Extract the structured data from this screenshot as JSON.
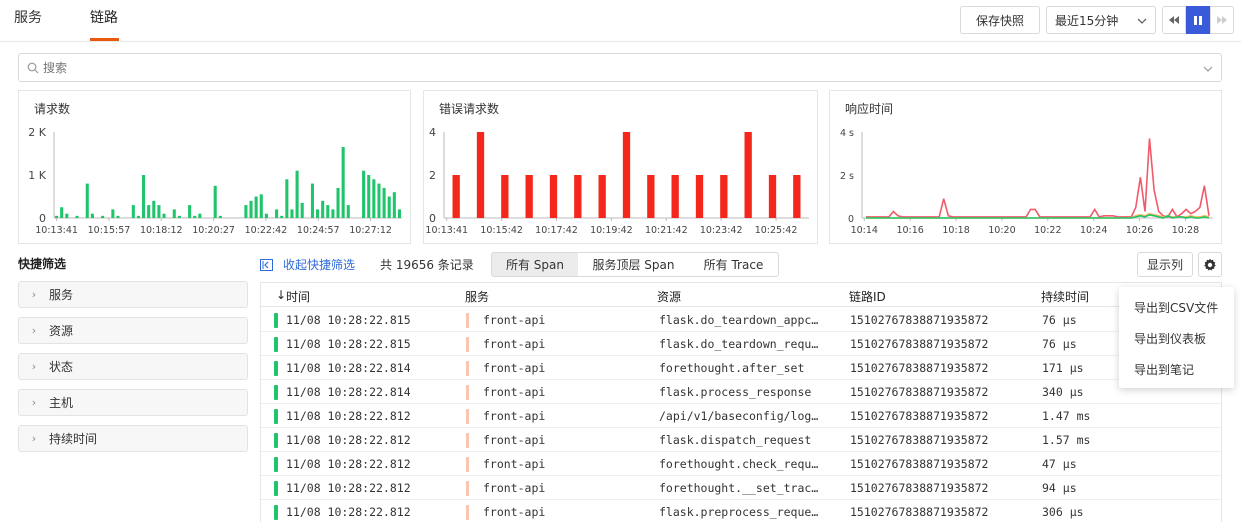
{
  "tabs": [
    {
      "label": "服务"
    },
    {
      "label": "链路"
    }
  ],
  "toolbar": {
    "save_label": "保存快照",
    "time_range": "最近15分钟"
  },
  "search": {
    "placeholder": "搜索"
  },
  "charts": {
    "requests_title": "请求数",
    "errors_title": "错误请求数",
    "latency_title": "响应时间"
  },
  "chart_data": [
    {
      "type": "bar",
      "title": "请求数",
      "color": "#20c46a",
      "ylim": [
        0,
        2000
      ],
      "yticks": [
        "2 K",
        "1 K",
        "0"
      ],
      "xticks": [
        "10:13:41",
        "10:15:57",
        "10:18:12",
        "10:20:27",
        "10:22:42",
        "10:24:57",
        "10:27:12"
      ],
      "values": [
        50,
        250,
        100,
        0,
        50,
        0,
        800,
        100,
        0,
        50,
        0,
        200,
        50,
        0,
        0,
        300,
        50,
        1000,
        300,
        400,
        300,
        100,
        0,
        200,
        50,
        0,
        300,
        50,
        100,
        0,
        0,
        750,
        50,
        0,
        0,
        0,
        0,
        300,
        400,
        500,
        550,
        100,
        0,
        200,
        50,
        900,
        200,
        1100,
        350,
        0,
        800,
        200,
        400,
        300,
        200,
        700,
        1650,
        300,
        0,
        0,
        1100,
        1000,
        900,
        800,
        700,
        500,
        600,
        200
      ]
    },
    {
      "type": "bar",
      "title": "错误请求数",
      "color": "#f5261b",
      "ylim": [
        0,
        4
      ],
      "yticks": [
        "4",
        "2",
        "0"
      ],
      "xticks": [
        "10:13:41",
        "10:15:42",
        "10:17:42",
        "10:19:42",
        "10:21:42",
        "10:23:42",
        "10:25:42"
      ],
      "values": [
        2,
        4,
        2,
        2,
        2,
        2,
        2,
        4,
        2,
        2,
        2,
        2,
        4,
        2,
        2
      ]
    },
    {
      "type": "line",
      "title": "响应时间",
      "ylim": [
        0,
        4
      ],
      "yticks": [
        "4 s",
        "2 s",
        "0"
      ],
      "xticks": [
        "10:14",
        "10:16",
        "10:18",
        "10:20",
        "10:22",
        "10:24",
        "10:26",
        "10:28"
      ],
      "series": [
        {
          "color": "#f05a6a",
          "values": [
            0.05,
            0.05,
            0.05,
            0.05,
            0.05,
            0.05,
            0.3,
            0.1,
            0.05,
            0.05,
            0.05,
            0.05,
            0.05,
            0.05,
            0.05,
            0.05,
            0.05,
            0.9,
            0.1,
            0.05,
            0.05,
            0.05,
            0.05,
            0.05,
            0.05,
            0.05,
            0.05,
            0.05,
            0.05,
            0.05,
            0.05,
            0.05,
            0.05,
            0.05,
            0.05,
            0.05,
            0.4,
            0.4,
            0.05,
            0.05,
            0.05,
            0.05,
            0.05,
            0.05,
            0.05,
            0.05,
            0.05,
            0.05,
            0.05,
            0.05,
            0.4,
            0.05,
            0.1,
            0.1,
            0.1,
            0.05,
            0.05,
            0.05,
            0.05,
            0.5,
            1.9,
            0.3,
            3.7,
            1.3,
            0.3,
            0.1,
            0.05,
            0.4,
            0.05,
            0.2,
            0.4,
            0.2,
            0.3,
            0.5,
            1.5,
            0.1
          ]
        },
        {
          "color": "#f7b955",
          "values": [
            0,
            0,
            0,
            0,
            0,
            0,
            0,
            0,
            0,
            0,
            0,
            0,
            0,
            0,
            0,
            0,
            0,
            0,
            0,
            0,
            0,
            0,
            0,
            0,
            0,
            0,
            0,
            0,
            0,
            0,
            0,
            0,
            0,
            0,
            0,
            0,
            0,
            0,
            0,
            0,
            0,
            0,
            0,
            0,
            0,
            0,
            0,
            0,
            0,
            0,
            0,
            0,
            0,
            0,
            0,
            0,
            0,
            0,
            0,
            0.1,
            0.15,
            0.1,
            0.2,
            0.15,
            0.1,
            0.05,
            0.1,
            0.05,
            0.05,
            0.05,
            0.05,
            0.1,
            0.05,
            0.05,
            0.1,
            0.05
          ]
        },
        {
          "color": "#20c46a",
          "values": [
            0,
            0,
            0,
            0,
            0,
            0,
            0,
            0,
            0,
            0,
            0,
            0,
            0,
            0,
            0,
            0,
            0,
            0,
            0,
            0,
            0,
            0,
            0,
            0,
            0,
            0,
            0,
            0,
            0,
            0,
            0,
            0,
            0,
            0,
            0,
            0,
            0,
            0,
            0,
            0,
            0,
            0,
            0,
            0,
            0,
            0,
            0,
            0,
            0,
            0,
            0,
            0,
            0,
            0,
            0,
            0,
            0,
            0,
            0,
            0.05,
            0.1,
            0.05,
            0.15,
            0.1,
            0.05,
            0,
            0.1,
            0,
            0.05,
            0.05,
            0,
            0.05,
            0,
            0,
            0.05,
            0
          ]
        }
      ]
    }
  ],
  "quick_filter": {
    "title": "快捷筛选",
    "collapse_label": "收起快捷筛选",
    "record_count": "共 19656 条记录",
    "facets": [
      "服务",
      "资源",
      "状态",
      "主机",
      "持续时间"
    ]
  },
  "span_tabs": [
    "所有 Span",
    "服务顶层 Span",
    "所有 Trace"
  ],
  "columns_button": "显示列",
  "table": {
    "headers": [
      "时间",
      "服务",
      "资源",
      "链路ID",
      "持续时间"
    ],
    "rows": [
      {
        "time": "11/08 10:28:22.815",
        "service": "front-api",
        "resource": "flask.do_teardown_appc…",
        "trace_id": "15102767838871935872",
        "duration": "76 µs"
      },
      {
        "time": "11/08 10:28:22.815",
        "service": "front-api",
        "resource": "flask.do_teardown_requ…",
        "trace_id": "15102767838871935872",
        "duration": "76 µs"
      },
      {
        "time": "11/08 10:28:22.814",
        "service": "front-api",
        "resource": "forethought.after_set",
        "trace_id": "15102767838871935872",
        "duration": "171 µs"
      },
      {
        "time": "11/08 10:28:22.814",
        "service": "front-api",
        "resource": "flask.process_response",
        "trace_id": "15102767838871935872",
        "duration": "340 µs"
      },
      {
        "time": "11/08 10:28:22.812",
        "service": "front-api",
        "resource": "/api/v1/baseconfig/log…",
        "trace_id": "15102767838871935872",
        "duration": "1.47 ms"
      },
      {
        "time": "11/08 10:28:22.812",
        "service": "front-api",
        "resource": "flask.dispatch_request",
        "trace_id": "15102767838871935872",
        "duration": "1.57 ms"
      },
      {
        "time": "11/08 10:28:22.812",
        "service": "front-api",
        "resource": "forethought.check_requ…",
        "trace_id": "15102767838871935872",
        "duration": "47 µs"
      },
      {
        "time": "11/08 10:28:22.812",
        "service": "front-api",
        "resource": "forethought.__set_trac…",
        "trace_id": "15102767838871935872",
        "duration": "94 µs"
      },
      {
        "time": "11/08 10:28:22.812",
        "service": "front-api",
        "resource": "flask.preprocess_reque…",
        "trace_id": "15102767838871935872",
        "duration": "306 µs"
      }
    ]
  },
  "export_menu": [
    "导出到CSV文件",
    "导出到仪表板",
    "导出到笔记"
  ],
  "colors": {
    "accent": "#e8590c",
    "play_active": "#3a5bd9",
    "link": "#2f6bd9",
    "success": "#20c46a",
    "error": "#f5261b"
  }
}
